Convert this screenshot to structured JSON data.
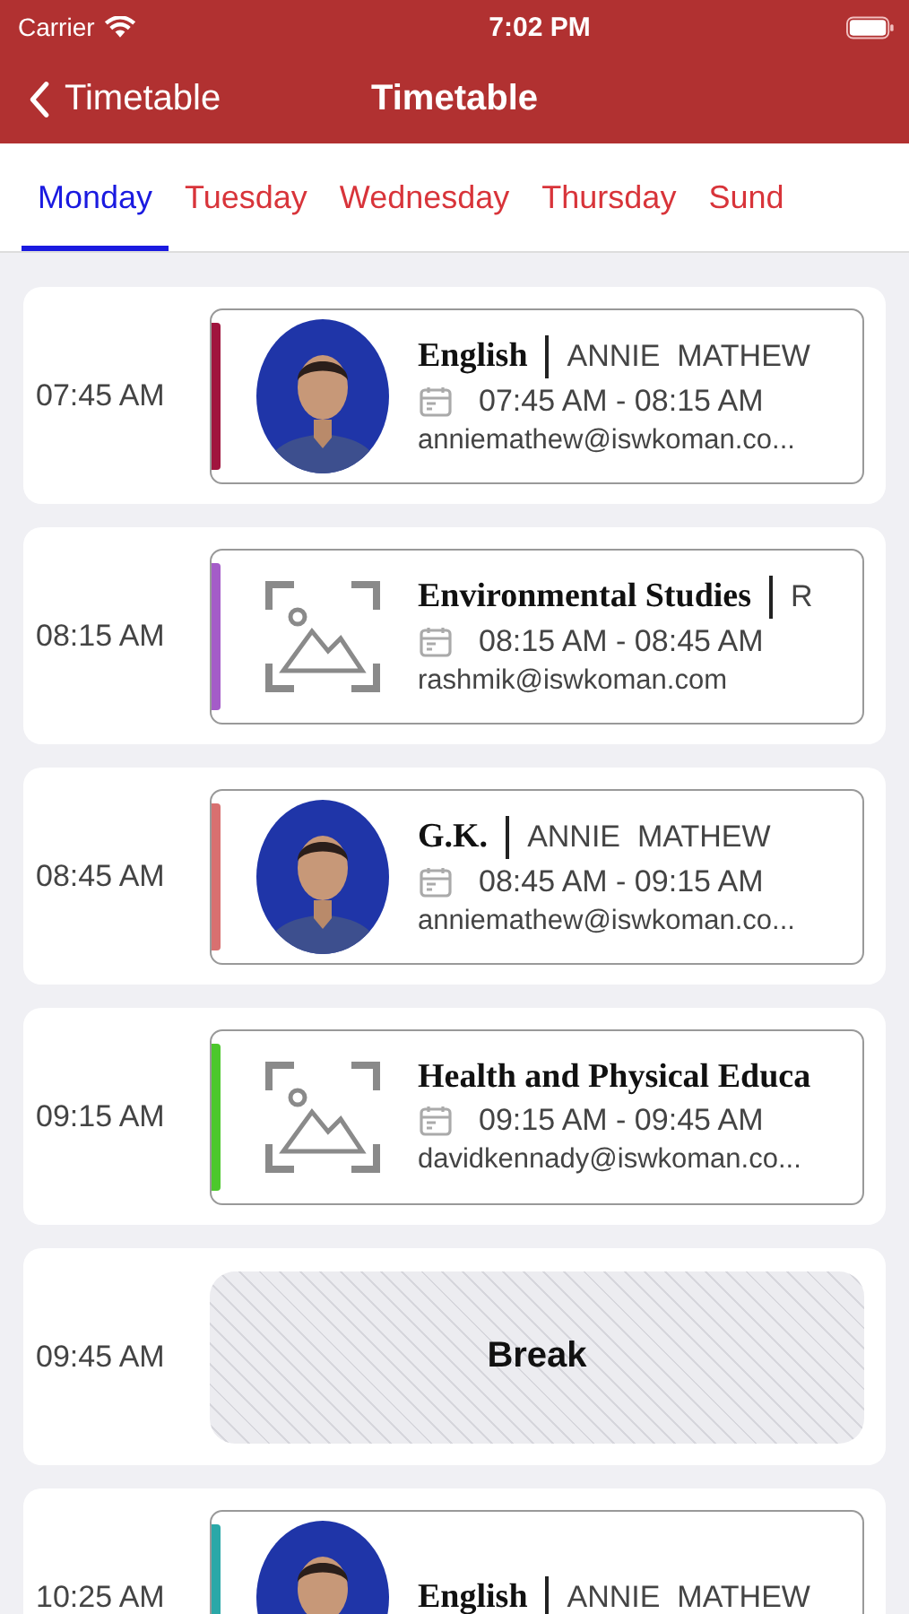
{
  "status_bar": {
    "carrier": "Carrier",
    "time": "7:02 PM"
  },
  "nav": {
    "back_label": "Timetable",
    "title": "Timetable"
  },
  "tabs": [
    {
      "label": "Monday",
      "selected": true
    },
    {
      "label": "Tuesday",
      "selected": false
    },
    {
      "label": "Wednesday",
      "selected": false
    },
    {
      "label": "Thursday",
      "selected": false
    },
    {
      "label": "Sund",
      "selected": false
    }
  ],
  "periods": [
    {
      "kind": "class",
      "time": "07:45 AM",
      "color": "#a0153e",
      "has_photo": true,
      "subject": "English",
      "teacher": "ANNIE  MATHEW",
      "range": "07:45 AM - 08:15 AM",
      "email": "anniemathew@iswkoman.co..."
    },
    {
      "kind": "class",
      "time": "08:15 AM",
      "color": "#a45cc8",
      "has_photo": false,
      "subject": "Environmental Studies",
      "teacher": "R",
      "range": "08:15 AM - 08:45 AM",
      "email": "rashmik@iswkoman.com"
    },
    {
      "kind": "class",
      "time": "08:45 AM",
      "color": "#d87070",
      "has_photo": true,
      "subject": "G.K.",
      "teacher": "ANNIE  MATHEW",
      "range": "08:45 AM - 09:15 AM",
      "email": "anniemathew@iswkoman.co..."
    },
    {
      "kind": "class",
      "time": "09:15 AM",
      "color": "#4cc82c",
      "has_photo": false,
      "subject": "Health and Physical Educa",
      "range": "09:15 AM - 09:45 AM",
      "email": "davidkennady@iswkoman.co..."
    },
    {
      "kind": "break",
      "time": "09:45 AM",
      "label": "Break"
    },
    {
      "kind": "class",
      "time": "10:25 AM",
      "color": "#2aa8a8",
      "has_photo": true,
      "subject": "English",
      "teacher": "ANNIE  MATHEW"
    }
  ]
}
